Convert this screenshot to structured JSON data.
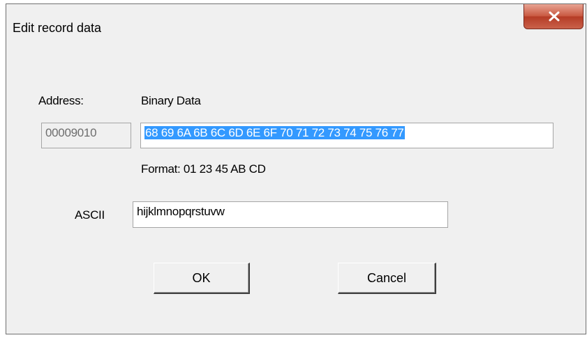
{
  "window": {
    "title": "Edit record data",
    "close_glyph": "close-icon"
  },
  "labels": {
    "address": "Address:",
    "binary_data": "Binary Data",
    "format": "Format:  01 23 45 AB CD",
    "ascii": "ASCII"
  },
  "fields": {
    "address_value": "00009010",
    "binary_value": "68 69 6A 6B 6C 6D 6E 6F 70 71 72 73 74 75 76 77",
    "ascii_value": "hijklmnopqrstuvw"
  },
  "buttons": {
    "ok": "OK",
    "cancel": "Cancel"
  },
  "colors": {
    "selection": "#3399ff",
    "close_button": "#c95a43",
    "dialog_bg": "#f0f0f0"
  }
}
